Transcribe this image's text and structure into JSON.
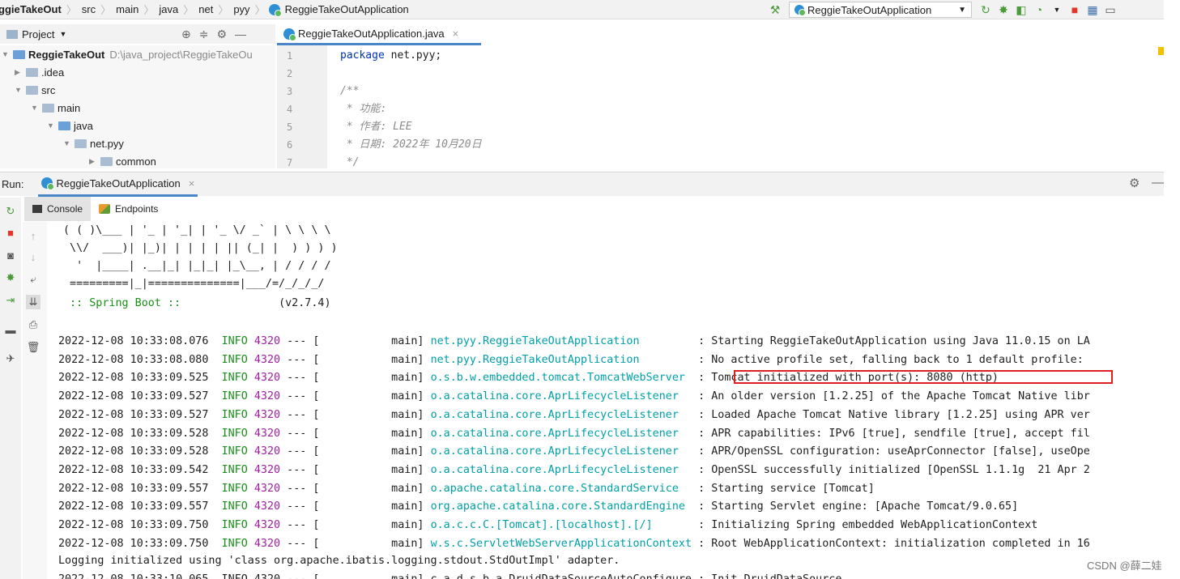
{
  "breadcrumbs": [
    "ggieTakeOut",
    "src",
    "main",
    "java",
    "net",
    "pyy",
    "ReggieTakeOutApplication"
  ],
  "run_config": {
    "label": "ReggieTakeOutApplication"
  },
  "project_panel": {
    "title": "Project"
  },
  "tree": [
    {
      "label": "ReggieTakeOut",
      "path": "D:\\java_project\\ReggieTakeOu",
      "bold": true
    },
    {
      "label": ".idea"
    },
    {
      "label": "src"
    },
    {
      "label": "main"
    },
    {
      "label": "java"
    },
    {
      "label": "net.pyy"
    },
    {
      "label": "common"
    }
  ],
  "editor": {
    "tab_label": "ReggieTakeOutApplication.java",
    "line_numbers": [
      "1",
      "2",
      "3",
      "4",
      "5",
      "6",
      "7"
    ],
    "code": {
      "line1_kw": "package",
      "line1_rest": " net.pyy;",
      "line3": "/**",
      "line4": " * 功能:",
      "line5": " * 作者: LEE",
      "line6": " * 日期: 2022年 10月20日",
      "line7": " */"
    }
  },
  "run_panel": {
    "label": "Run:",
    "tab_label": "ReggieTakeOutApplication",
    "subtabs": [
      "Console",
      "Endpoints"
    ]
  },
  "console": {
    "banner": [
      "( ( )\\___ | '_ | '_| | '_ \\/ _` | \\ \\ \\ \\",
      " \\\\/  ___)| |_)| | | | | || (_| |  ) ) ) )",
      "  '  |____| .__|_| |_|_| |_\\__, | / / / /",
      " =========|_|==============|___/=/_/_/_/"
    ],
    "spring_label": " :: Spring Boot ::",
    "spring_version": "(v2.7.4)",
    "log_lines": [
      {
        "ts": "2022-12-08 10:33:08.076",
        "level": "INFO",
        "pid": "4320",
        "thread": " --- [           main] ",
        "logger": "net.pyy.ReggieTakeOutApplication        ",
        "msg": " : Starting ReggieTakeOutApplication using Java 11.0.15 on LA"
      },
      {
        "ts": "2022-12-08 10:33:08.080",
        "level": "INFO",
        "pid": "4320",
        "thread": " --- [           main] ",
        "logger": "net.pyy.ReggieTakeOutApplication        ",
        "msg": " : No active profile set, falling back to 1 default profile:"
      },
      {
        "ts": "2022-12-08 10:33:09.525",
        "level": "INFO",
        "pid": "4320",
        "thread": " --- [           main] ",
        "logger": "o.s.b.w.embedded.tomcat.TomcatWebServer",
        "msg": "  : Tomcat initialized with port(s): 8080 (http)"
      },
      {
        "ts": "2022-12-08 10:33:09.527",
        "level": "INFO",
        "pid": "4320",
        "thread": " --- [           main] ",
        "logger": "o.a.catalina.core.AprLifecycleListener  ",
        "msg": " : An older version [1.2.25] of the Apache Tomcat Native libr"
      },
      {
        "ts": "2022-12-08 10:33:09.527",
        "level": "INFO",
        "pid": "4320",
        "thread": " --- [           main] ",
        "logger": "o.a.catalina.core.AprLifecycleListener  ",
        "msg": " : Loaded Apache Tomcat Native library [1.2.25] using APR ver"
      },
      {
        "ts": "2022-12-08 10:33:09.528",
        "level": "INFO",
        "pid": "4320",
        "thread": " --- [           main] ",
        "logger": "o.a.catalina.core.AprLifecycleListener  ",
        "msg": " : APR capabilities: IPv6 [true], sendfile [true], accept fil"
      },
      {
        "ts": "2022-12-08 10:33:09.528",
        "level": "INFO",
        "pid": "4320",
        "thread": " --- [           main] ",
        "logger": "o.a.catalina.core.AprLifecycleListener  ",
        "msg": " : APR/OpenSSL configuration: useAprConnector [false], useOpe"
      },
      {
        "ts": "2022-12-08 10:33:09.542",
        "level": "INFO",
        "pid": "4320",
        "thread": " --- [           main] ",
        "logger": "o.a.catalina.core.AprLifecycleListener  ",
        "msg": " : OpenSSL successfully initialized [OpenSSL 1.1.1g  21 Apr 2"
      },
      {
        "ts": "2022-12-08 10:33:09.557",
        "level": "INFO",
        "pid": "4320",
        "thread": " --- [           main] ",
        "logger": "o.apache.catalina.core.StandardService  ",
        "msg": " : Starting service [Tomcat]"
      },
      {
        "ts": "2022-12-08 10:33:09.557",
        "level": "INFO",
        "pid": "4320",
        "thread": " --- [           main] ",
        "logger": "org.apache.catalina.core.StandardEngine ",
        "msg": " : Starting Servlet engine: [Apache Tomcat/9.0.65]"
      },
      {
        "ts": "2022-12-08 10:33:09.750",
        "level": "INFO",
        "pid": "4320",
        "thread": " --- [           main] ",
        "logger": "o.a.c.c.C.[Tomcat].[localhost].[/]      ",
        "msg": " : Initializing Spring embedded WebApplicationContext"
      },
      {
        "ts": "2022-12-08 10:33:09.750",
        "level": "INFO",
        "pid": "4320",
        "thread": " --- [           main] ",
        "logger": "w.s.c.ServletWebServerApplicationContext",
        "msg": " : Root WebApplicationContext: initialization completed in 16"
      }
    ],
    "plain_line": "Logging initialized using 'class org.apache.ibatis.logging.stdout.StdOutImpl' adapter.",
    "partial_line": "2022-12-08 10:33:10.065  INFO 4320 --- [           main] c.a.d.s.b.a.DruidDataSourceAutoConfigure : Init DruidDataSource"
  },
  "watermark": "CSDN @薛二娃"
}
